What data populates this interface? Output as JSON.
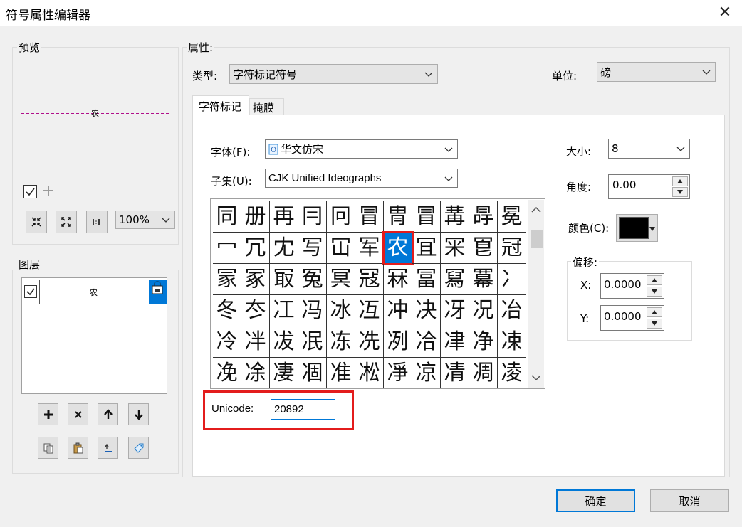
{
  "window": {
    "title": "符号属性编辑器",
    "close_glyph": "✕"
  },
  "preview": {
    "label": "预览",
    "glyph": "农",
    "zoom": "100%",
    "draw_checked": true,
    "icons": [
      "add-icon",
      "zoom-in-icon",
      "zoom-out-icon",
      "actual-size-icon"
    ]
  },
  "layers": {
    "label": "图层",
    "items": [
      {
        "glyph": "农",
        "checked": true
      }
    ],
    "icons": [
      "plus-icon",
      "delete-icon",
      "arrow-up-icon",
      "arrow-down-icon",
      "copy-icon",
      "paste-icon",
      "reset-icon",
      "tag-icon"
    ]
  },
  "properties": {
    "label": "属性:",
    "type_label": "类型:",
    "type_value": "字符标记符号",
    "unit_label": "单位:",
    "unit_value": "磅",
    "tabs": [
      {
        "label": "字符标记",
        "active": true
      },
      {
        "label": "掩膜",
        "active": false
      }
    ],
    "font_label": "字体(F):",
    "font_value": "华文仿宋",
    "subset_label": "子集(U):",
    "subset_value": "CJK Unified Ideographs",
    "size_label": "大小:",
    "size_value": "8",
    "angle_label": "角度:",
    "angle_value": "0.00",
    "color_label": "颜色(C):",
    "color_value": "#000000",
    "offset_label": "偏移:",
    "offset_x_label": "X:",
    "offset_x_value": "0.0000",
    "offset_y_label": "Y:",
    "offset_y_value": "0.0000",
    "unicode_label": "Unicode:",
    "unicode_value": "20892"
  },
  "char_grid": {
    "selected_row": 1,
    "selected_col": 6,
    "rows": [
      [
        "同",
        "册",
        "再",
        "冃",
        "冋",
        "冒",
        "冑",
        "冒",
        "冓",
        "冔",
        "冕"
      ],
      [
        "冖",
        "冗",
        "冘",
        "写",
        "冚",
        "军",
        "农",
        "冝",
        "冞",
        "冟",
        "冠"
      ],
      [
        "冡",
        "冢",
        "冣",
        "冤",
        "冥",
        "冦",
        "冧",
        "冨",
        "冩",
        "冪",
        "冫"
      ],
      [
        "冬",
        "冭",
        "冮",
        "冯",
        "冰",
        "冱",
        "冲",
        "决",
        "冴",
        "况",
        "冶"
      ],
      [
        "冷",
        "冸",
        "冹",
        "冺",
        "冻",
        "冼",
        "冽",
        "冾",
        "冿",
        "净",
        "凁"
      ],
      [
        "凂",
        "凃",
        "凄",
        "凅",
        "准",
        "凇",
        "凈",
        "凉",
        "凊",
        "凋",
        "凌"
      ]
    ]
  },
  "buttons": {
    "ok": "确定",
    "cancel": "取消"
  }
}
